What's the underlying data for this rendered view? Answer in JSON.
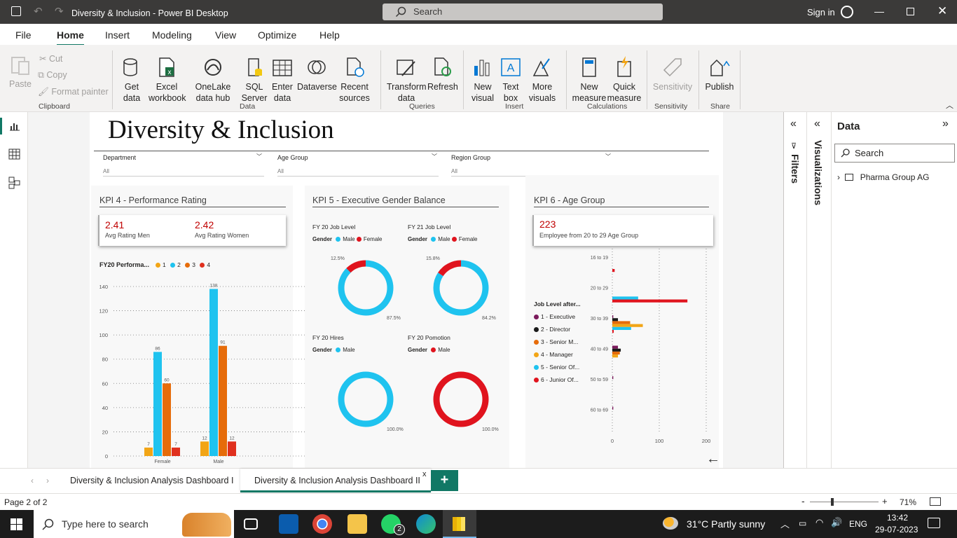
{
  "window": {
    "title": "Diversity & Inclusion - Power BI Desktop",
    "search_placeholder": "Search",
    "signin": "Sign in"
  },
  "menu": [
    "File",
    "Home",
    "Insert",
    "Modeling",
    "View",
    "Optimize",
    "Help"
  ],
  "ribbon": {
    "paste": "Paste",
    "cut": "Cut",
    "copy": "Copy",
    "format_painter": "Format painter",
    "get_data": "Get data",
    "excel": "Excel workbook",
    "onelake": "OneLake data hub",
    "sql": "SQL Server",
    "enter": "Enter data",
    "dataverse": "Dataverse",
    "recent": "Recent sources",
    "transform": "Transform data",
    "refresh": "Refresh",
    "new_visual": "New visual",
    "text_box": "Text box",
    "more_visuals": "More visuals",
    "new_measure": "New measure",
    "quick_measure": "Quick measure",
    "sensitivity": "Sensitivity",
    "publish": "Publish",
    "groups": [
      "Clipboard",
      "Data",
      "Queries",
      "Insert",
      "Calculations",
      "Sensitivity",
      "Share"
    ]
  },
  "report": {
    "title": "Diversity & Inclusion",
    "slicers": [
      {
        "label": "Department",
        "value": "All"
      },
      {
        "label": "Age Group",
        "value": "All"
      },
      {
        "label": "Region Group",
        "value": "All"
      }
    ],
    "kpi4": {
      "title": "KPI 4 - Performance Rating",
      "men_value": "2.41",
      "men_label": "Avg Rating Men",
      "women_value": "2.42",
      "women_label": "Avg Rating Women",
      "chart_title": "FY20 Performa...",
      "legend": [
        "1",
        "2",
        "3",
        "4"
      ]
    },
    "kpi5": {
      "title": "KPI 5 - Executive Gender Balance",
      "gender_label": "Gender",
      "male": "Male",
      "female": "Female",
      "c1": "FY 20 Job Level",
      "c2": "FY 21 Job Level",
      "c3": "FY 20 Hires",
      "c4": "FY 20 Pomotion"
    },
    "kpi6": {
      "title": "KPI 6 - Age Group",
      "value": "223",
      "value_label": "Employee from 20 to 29 Age Group",
      "legend_title": "Job Level after...",
      "legend": [
        "1 - Executive",
        "2 - Director",
        "3 - Senior M...",
        "4 - Manager",
        "5 - Senior Of...",
        "6 - Junior Of..."
      ]
    }
  },
  "chart_data": [
    {
      "type": "bar",
      "title": "FY20 Performa...",
      "categories": [
        "Female",
        "Male"
      ],
      "ylim": [
        0,
        140
      ],
      "yticks": [
        0,
        20,
        40,
        60,
        80,
        100,
        120,
        140
      ],
      "series": [
        {
          "name": "1",
          "color": "#f2a516",
          "values": [
            7,
            12
          ]
        },
        {
          "name": "2",
          "color": "#1fc3ef",
          "values": [
            86,
            138
          ]
        },
        {
          "name": "3",
          "color": "#e66c0a",
          "values": [
            60,
            91
          ]
        },
        {
          "name": "4",
          "color": "#e0301e",
          "values": [
            7,
            12
          ]
        }
      ]
    },
    {
      "type": "pie",
      "title": "FY 20 Job Level",
      "slices": [
        {
          "name": "Male",
          "value": 87.5,
          "label": "87.5%",
          "color": "#1fc3ef"
        },
        {
          "name": "Female",
          "value": 12.5,
          "label": "12.5%",
          "color": "#e0141e"
        }
      ]
    },
    {
      "type": "pie",
      "title": "FY 21 Job Level",
      "slices": [
        {
          "name": "Male",
          "value": 84.2,
          "label": "84.2%",
          "color": "#1fc3ef"
        },
        {
          "name": "Female",
          "value": 15.8,
          "label": "15.8%",
          "color": "#e0141e"
        }
      ]
    },
    {
      "type": "pie",
      "title": "FY 20 Hires",
      "slices": [
        {
          "name": "Male",
          "value": 100,
          "label": "100.0%",
          "color": "#1fc3ef"
        }
      ]
    },
    {
      "type": "pie",
      "title": "FY 20 Pomotion",
      "slices": [
        {
          "name": "Male",
          "value": 100,
          "label": "100.0%",
          "color": "#e0141e"
        }
      ]
    },
    {
      "type": "bar",
      "orientation": "horizontal",
      "title": "KPI 6 - Age Group",
      "categories": [
        "16 to 19",
        "20 to 29",
        "30 to 39",
        "40 to 49",
        "50 to 59",
        "60 to 69"
      ],
      "xlim": [
        0,
        200
      ],
      "xticks": [
        0,
        100,
        200
      ],
      "series": [
        {
          "name": "1 - Executive",
          "color": "#7b1a5c",
          "values": [
            0,
            0,
            2,
            12,
            2,
            2
          ]
        },
        {
          "name": "2 - Director",
          "color": "#1a1a1a",
          "values": [
            0,
            0,
            12,
            18,
            0,
            0
          ]
        },
        {
          "name": "3 - Senior M...",
          "color": "#e66c0a",
          "values": [
            0,
            0,
            38,
            16,
            0,
            0
          ]
        },
        {
          "name": "4 - Manager",
          "color": "#f2a516",
          "values": [
            0,
            0,
            65,
            12,
            0,
            0
          ]
        },
        {
          "name": "5 - Senior Of...",
          "color": "#1fc3ef",
          "values": [
            0,
            55,
            40,
            0,
            0,
            0
          ]
        },
        {
          "name": "6 - Junior Of...",
          "color": "#e0141e",
          "values": [
            5,
            160,
            3,
            0,
            0,
            0
          ]
        }
      ]
    }
  ],
  "panes": {
    "filters": "Filters",
    "visualizations": "Visualizations",
    "data": "Data",
    "search": "Search",
    "table": "Pharma Group AG"
  },
  "tabs": [
    "Diversity & Inclusion Analysis Dashboard I",
    "Diversity & Inclusion Analysis Dashboard II"
  ],
  "status": {
    "page": "Page 2 of 2",
    "zoom": "71%"
  },
  "taskbar": {
    "search": "Type here to search",
    "weather": "31°C  Partly sunny",
    "lang": "ENG",
    "time": "13:42",
    "date": "29-07-2023",
    "whatsapp_badge": "2"
  }
}
